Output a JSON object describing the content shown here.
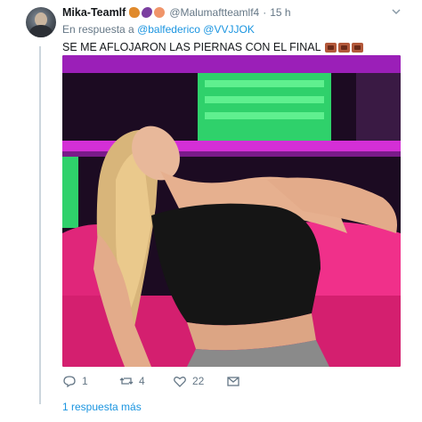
{
  "tweet": {
    "display_name": "Mika-Teamlf",
    "handle": "@Malumaftteamlf4",
    "separator": "·",
    "timestamp": "15 h",
    "name_emoji_icons": [
      "dancer-emoji-icon",
      "eggplant-emoji-icon",
      "peach-emoji-icon"
    ],
    "reply_prefix": "En respuesta a",
    "reply_users": [
      "@balfederico",
      "@VVJJOK"
    ],
    "text": "SE ME AFLOJARON LAS PIERNAS CON EL FINAL",
    "text_emoji_icons": [
      "see-no-evil-emoji-icon",
      "see-no-evil-emoji-icon",
      "see-no-evil-emoji-icon"
    ],
    "media": {
      "type": "image",
      "description_icon": "photo-icon"
    },
    "actions": {
      "reply_count": "1",
      "retweet_count": "4",
      "like_count": "22",
      "dm_label": ""
    },
    "more_replies_label": "1 respuesta más"
  },
  "colors": {
    "link": "#1b95e0",
    "muted": "#657786",
    "text": "#14171a",
    "thread_line": "#ccd6dd"
  }
}
